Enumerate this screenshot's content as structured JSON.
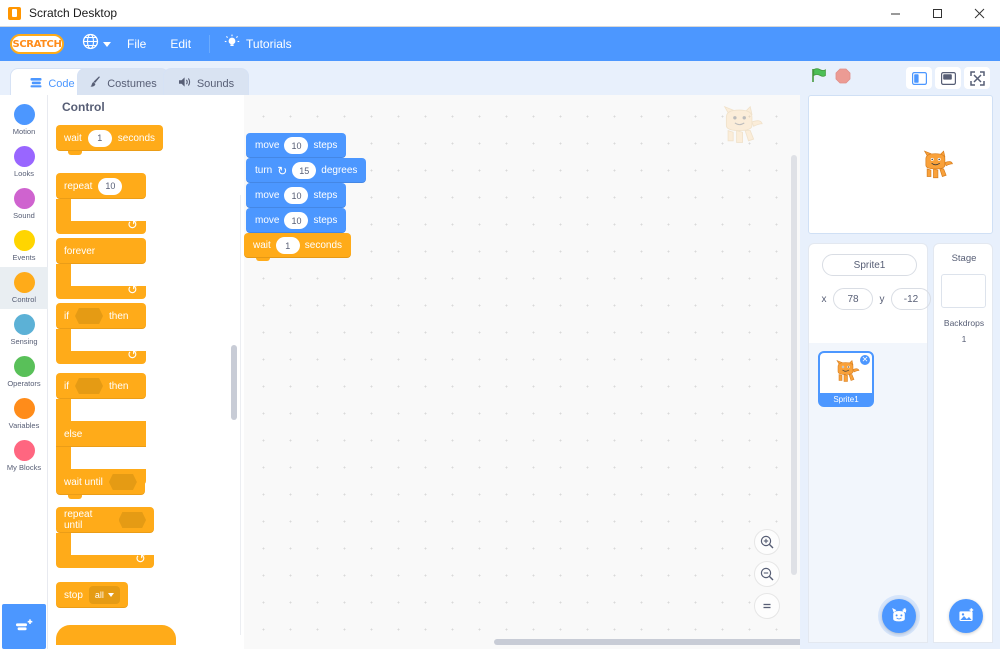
{
  "window": {
    "title": "Scratch Desktop",
    "icon": "scratch-app-icon",
    "minimize": "minimize-icon",
    "maximize": "maximize-icon",
    "close": "close-icon"
  },
  "menubar": {
    "logo_text": "SCRATCH",
    "globe_icon": "globe-icon",
    "items": [
      {
        "label": "File"
      },
      {
        "label": "Edit"
      }
    ],
    "tutorials": {
      "label": "Tutorials",
      "icon": "lightbulb-icon"
    }
  },
  "tabs": [
    {
      "label": "Code",
      "icon": "code-blocks-icon",
      "active": true
    },
    {
      "label": "Costumes",
      "icon": "paintbrush-icon",
      "active": false
    },
    {
      "label": "Sounds",
      "icon": "speaker-icon",
      "active": false
    }
  ],
  "stage_controls": {
    "green_flag": "green-flag-icon",
    "stop": "stop-sign-icon",
    "small_stage": "small-stage-icon",
    "large_stage": "large-stage-icon",
    "fullscreen": "fullscreen-icon"
  },
  "categories": [
    {
      "label": "Motion",
      "color": "#4c97ff",
      "selected": false
    },
    {
      "label": "Looks",
      "color": "#9966ff",
      "selected": false
    },
    {
      "label": "Sound",
      "color": "#cf63cf",
      "selected": false
    },
    {
      "label": "Events",
      "color": "#ffd500",
      "selected": false
    },
    {
      "label": "Control",
      "color": "#ffab19",
      "selected": true
    },
    {
      "label": "Sensing",
      "color": "#5cb1d6",
      "selected": false
    },
    {
      "label": "Operators",
      "color": "#59c059",
      "selected": false
    },
    {
      "label": "Variables",
      "color": "#ff8c1a",
      "selected": false
    },
    {
      "label": "My Blocks",
      "color": "#ff6680",
      "selected": false
    }
  ],
  "palette": {
    "heading": "Control",
    "blocks": [
      {
        "id": "wait",
        "parts": [
          "wait",
          "1",
          "seconds"
        ]
      },
      {
        "id": "repeat",
        "parts": [
          "repeat",
          "10"
        ]
      },
      {
        "id": "forever",
        "parts": [
          "forever"
        ]
      },
      {
        "id": "if-then",
        "parts": [
          "if",
          "then"
        ]
      },
      {
        "id": "if-else",
        "parts": [
          "if",
          "then",
          "else"
        ]
      },
      {
        "id": "wait-until",
        "parts": [
          "wait until"
        ]
      },
      {
        "id": "repeat-until",
        "parts": [
          "repeat until"
        ]
      },
      {
        "id": "stop",
        "parts": [
          "stop",
          "all"
        ]
      }
    ],
    "wait_label": "wait",
    "wait_value": "1",
    "seconds_label": "seconds",
    "repeat_label": "repeat",
    "repeat_value": "10",
    "forever_label": "forever",
    "if_label": "if",
    "then_label": "then",
    "else_label": "else",
    "wait_until_label": "wait until",
    "repeat_until_label": "repeat until",
    "stop_label": "stop",
    "stop_option": "all"
  },
  "script": {
    "blocks": [
      {
        "kind": "motion",
        "label": "move",
        "value": "10",
        "suffix": "steps"
      },
      {
        "kind": "motion",
        "label": "turn",
        "icon": "turn-right-icon",
        "value": "15",
        "suffix": "degrees"
      },
      {
        "kind": "motion",
        "label": "move",
        "value": "10",
        "suffix": "steps"
      },
      {
        "kind": "motion",
        "label": "move",
        "value": "10",
        "suffix": "steps"
      },
      {
        "kind": "control",
        "label": "wait",
        "value": "1",
        "suffix": "seconds"
      }
    ]
  },
  "workspace": {
    "watermark": "scratch-cat-watermark",
    "zoom_in": "zoom-in-icon",
    "zoom_out": "zoom-out-icon",
    "zoom_reset": "zoom-reset-icon"
  },
  "stage": {
    "sprite_icon": "scratch-cat-sprite"
  },
  "sprite_info": {
    "name_value": "Sprite1",
    "x_label": "x",
    "x_value": "78",
    "y_label": "y",
    "y_value": "-12"
  },
  "sprite_list": {
    "items": [
      {
        "name": "Sprite1",
        "selected": true,
        "delete_icon": "delete-badge-icon"
      }
    ]
  },
  "stage_panel": {
    "title": "Stage",
    "backdrops_label": "Backdrops",
    "backdrops_count": "1"
  },
  "fabs": {
    "choose_sprite": "choose-a-sprite-icon",
    "choose_backdrop": "choose-a-backdrop-icon",
    "add_extension": "add-extension-icon"
  },
  "colors": {
    "brand_blue": "#4c97ff",
    "control_orange": "#ffab19",
    "panel_bg": "#e8f0fc",
    "workspace_bg": "#f9f9f9"
  }
}
